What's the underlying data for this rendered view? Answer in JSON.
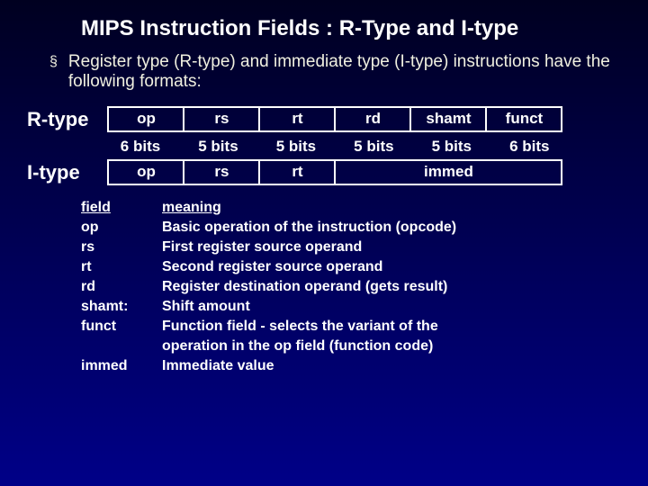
{
  "title": "MIPS Instruction Fields : R-Type and I-type",
  "bullet": "Register type (R-type) and immediate type (I-type) instructions have the following formats:",
  "labels": {
    "r": "R-type",
    "i": "I-type"
  },
  "rfields": {
    "op": "op",
    "rs": "rs",
    "rt": "rt",
    "rd": "rd",
    "shamt": "shamt",
    "funct": "funct"
  },
  "bits": {
    "b6a": "6 bits",
    "b5a": "5 bits",
    "b5b": "5 bits",
    "b5c": "5 bits",
    "b5d": "5 bits",
    "b6b": "6 bits"
  },
  "ifields": {
    "op": "op",
    "rs": "rs",
    "rt": "rt",
    "immed": "immed"
  },
  "defs": {
    "h_term": "field",
    "h_mean": "meaning",
    "op_t": "op",
    "op_m": "Basic operation of the instruction (opcode)",
    "rs_t": "rs",
    "rs_m": "First register source operand",
    "rt_t": "rt",
    "rt_m": "Second register source operand",
    "rd_t": "rd",
    "rd_m": "Register destination operand (gets result)",
    "shamt_t": "shamt:",
    "shamt_m": "Shift amount",
    "funct_t": "funct",
    "funct_m1": "Function field - selects the variant of the",
    "funct_m2": "operation in the op field (function code)",
    "immed_t": "immed",
    "immed_m": "Immediate value"
  }
}
